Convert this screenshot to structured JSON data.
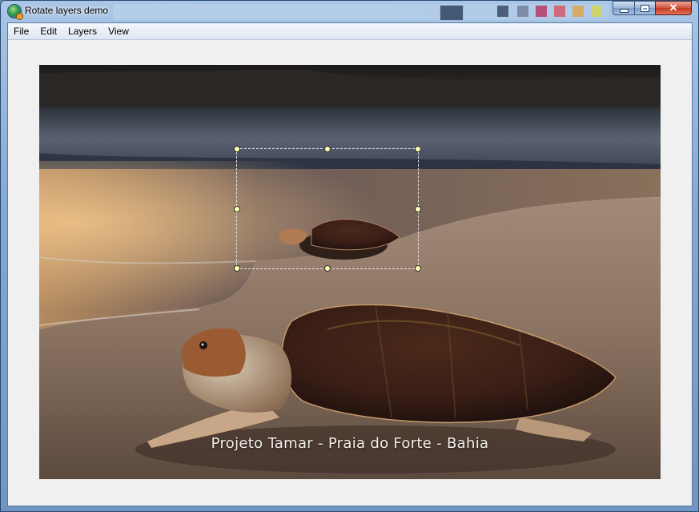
{
  "window": {
    "title": "Rotate layers demo",
    "close_glyph": "✕"
  },
  "menu": {
    "items": [
      {
        "label": "File"
      },
      {
        "label": "Edit"
      },
      {
        "label": "Layers"
      },
      {
        "label": "View"
      }
    ]
  },
  "canvas": {
    "caption": "Projeto Tamar - Praia do Forte - Bahia"
  },
  "icons": {
    "app": "globe-icon",
    "minimize": "minimize-icon",
    "maximize": "maximize-icon",
    "close": "close-icon"
  },
  "colors": {
    "handle_fill": "#ffffb4",
    "selection_border": "#e6e6e6",
    "close_button": "#c4391f"
  }
}
